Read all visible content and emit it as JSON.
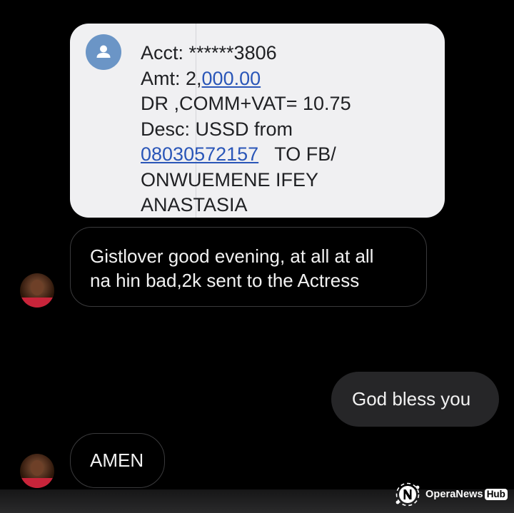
{
  "sms_card": {
    "lines": [
      {
        "text": "Acct: ******3806"
      },
      {
        "prefix": "Amt: 2,",
        "link": "000.00"
      },
      {
        "text": "DR ,COMM+VAT= 10.75"
      },
      {
        "text": "Desc: USSD from"
      },
      {
        "link": "08030572157",
        "suffix": "   TO FB/"
      },
      {
        "text": "ONWUEMENE IFEY"
      },
      {
        "text": "ANASTASIA"
      }
    ],
    "avatar_icon": "person-icon",
    "link_color": "#2a56b8"
  },
  "messages": [
    {
      "direction": "received",
      "text_line1": "Gistlover good evening, at all at all",
      "text_line2": "na hin bad,2k sent to the Actress"
    },
    {
      "direction": "sent",
      "text": "God bless you"
    },
    {
      "direction": "received",
      "text": "AMEN"
    }
  ],
  "watermark": {
    "brand": "OperaNews",
    "badge": "Hub",
    "icon": "operanews-logo-icon"
  },
  "colors": {
    "background": "#000000",
    "sent_bubble": "#262628",
    "received_border": "#3a3a3c",
    "card_bg": "#f0f0f2"
  }
}
